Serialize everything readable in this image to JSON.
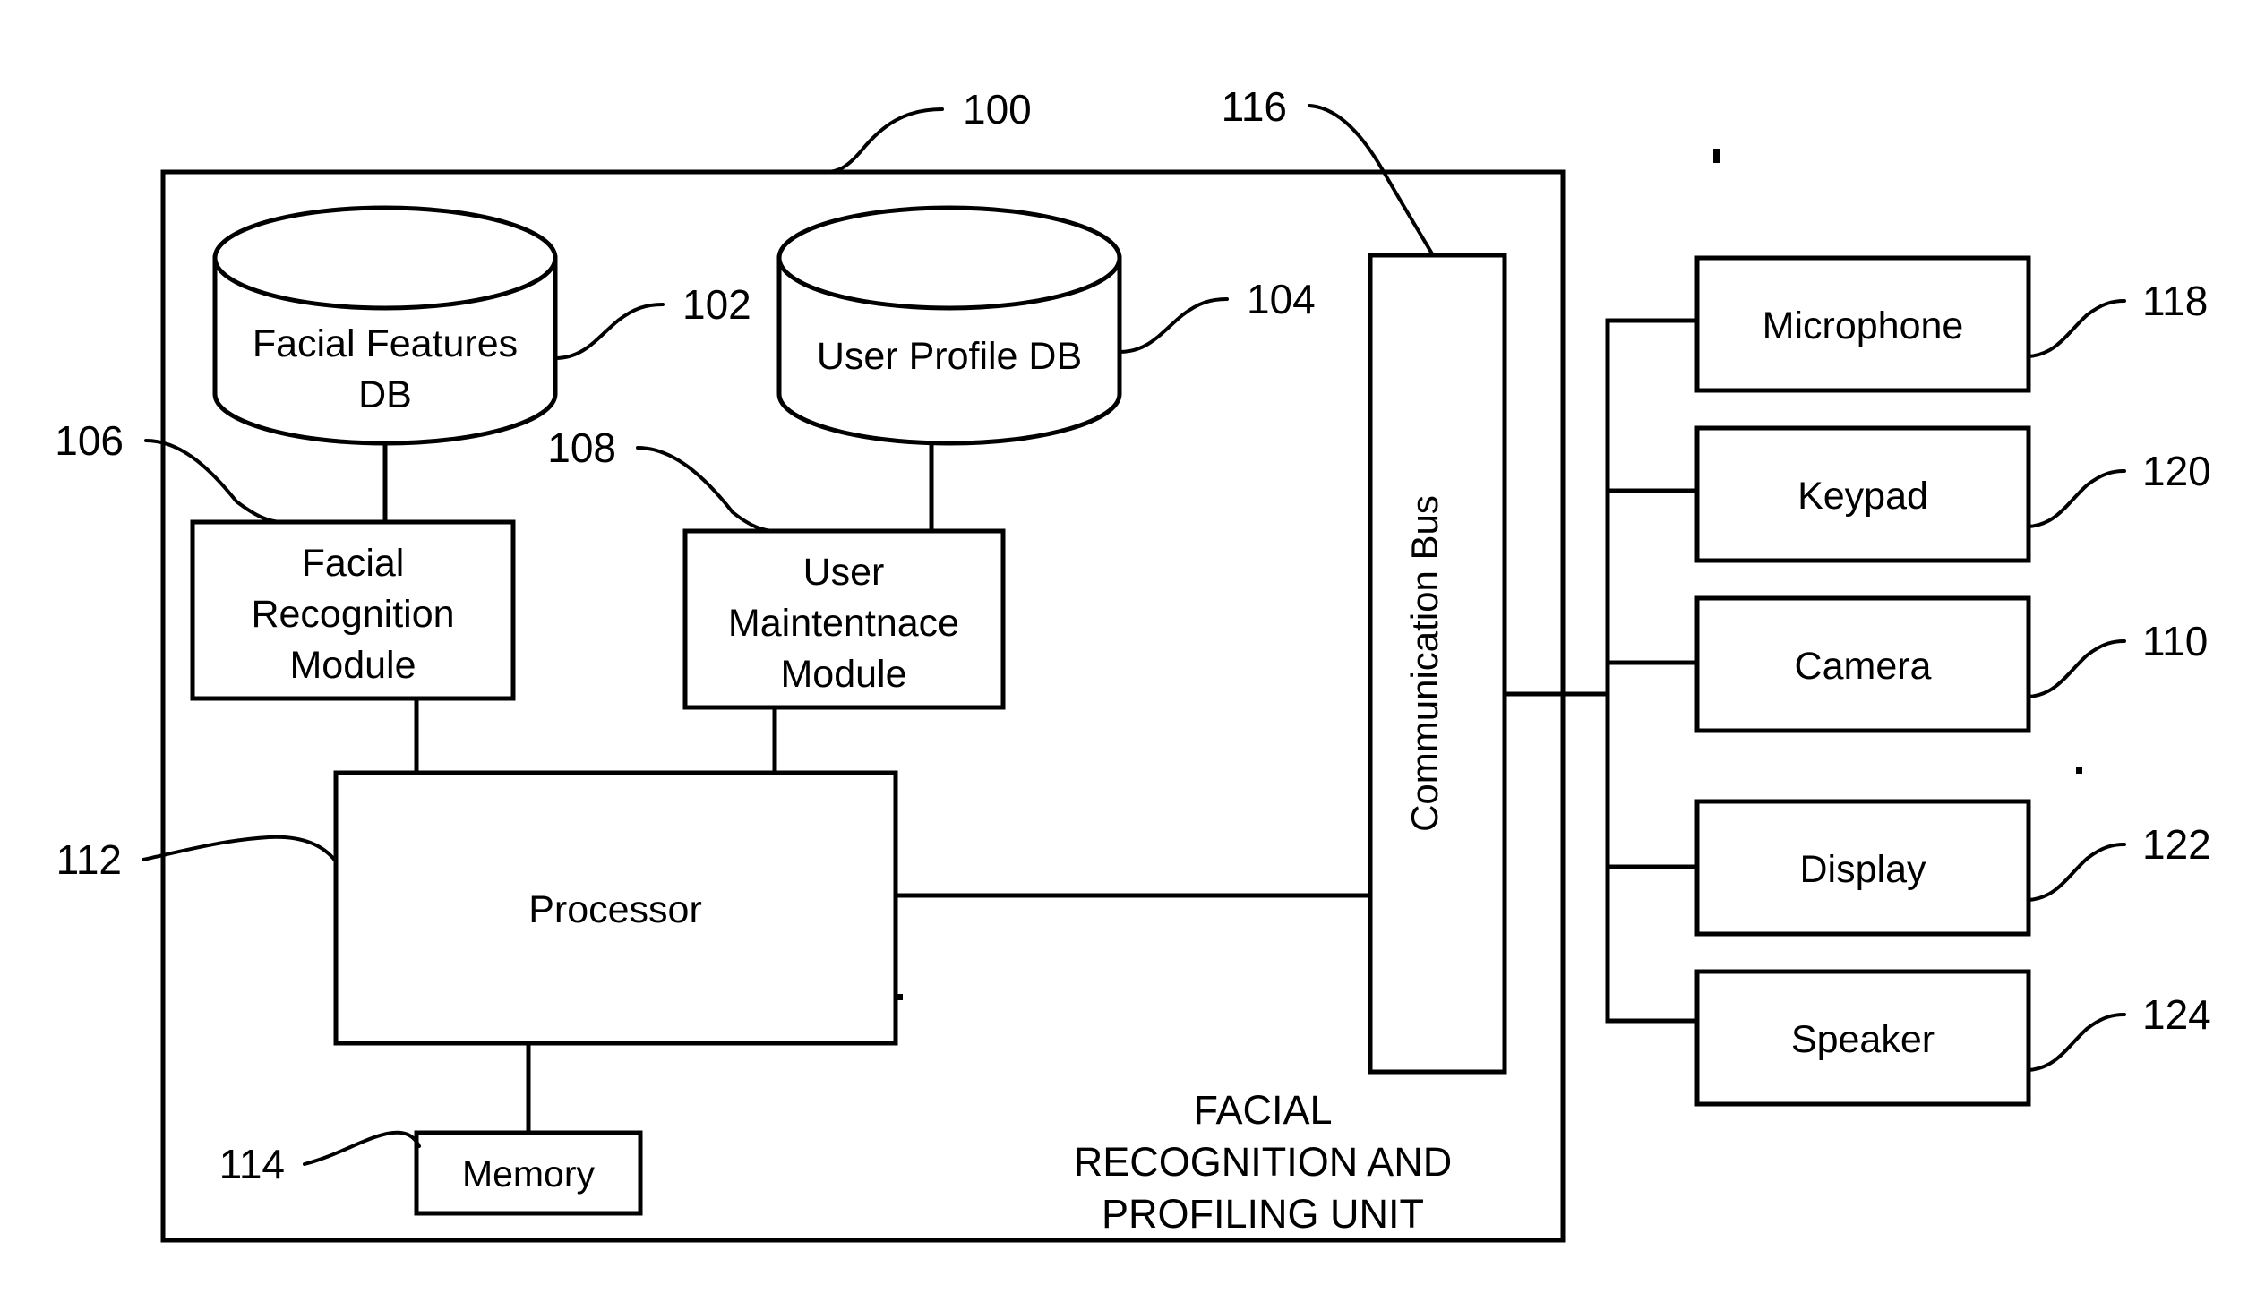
{
  "figure": {
    "unit_caption_lines": [
      "FACIAL",
      "RECOGNITION AND",
      "PROFILING UNIT"
    ],
    "unit_ref": "100",
    "bus_ref": "116",
    "bus_label": "Communication Bus"
  },
  "databases": [
    {
      "id": "facial-features-db",
      "lines": [
        "Facial Features",
        "DB"
      ],
      "ref": "102"
    },
    {
      "id": "user-profile-db",
      "lines": [
        "User Profile DB"
      ],
      "ref": "104"
    }
  ],
  "modules": [
    {
      "id": "facial-recognition-module",
      "lines": [
        "Facial",
        "Recognition",
        "Module"
      ],
      "ref": "106"
    },
    {
      "id": "user-maintenance-module",
      "lines": [
        "User",
        "Maintentnace",
        "Module"
      ],
      "ref": "108"
    }
  ],
  "core": [
    {
      "id": "processor",
      "label": "Processor",
      "ref": "112"
    },
    {
      "id": "memory",
      "label": "Memory",
      "ref": "114"
    }
  ],
  "peripherals": [
    {
      "id": "microphone",
      "label": "Microphone",
      "ref": "118"
    },
    {
      "id": "keypad",
      "label": "Keypad",
      "ref": "120"
    },
    {
      "id": "camera",
      "label": "Camera",
      "ref": "110"
    },
    {
      "id": "display",
      "label": "Display",
      "ref": "122"
    },
    {
      "id": "speaker",
      "label": "Speaker",
      "ref": "124"
    }
  ],
  "colors": {
    "ink": "#000000",
    "paper": "#ffffff"
  }
}
